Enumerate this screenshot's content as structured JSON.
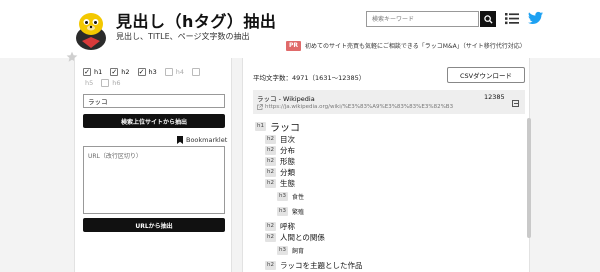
{
  "header": {
    "title": "見出し（hタグ）抽出",
    "subtitle": "見出し、TITLE、ページ文字数の抽出",
    "search_placeholder": "検索キーワード",
    "icons": [
      "mascot-logo",
      "search-icon",
      "menu-list-icon",
      "twitter-icon"
    ]
  },
  "pr": {
    "badge": "PR",
    "text": "初めてのサイト売買も気軽にご相談できる「ラッコM&A」（サイト移行代行対応）"
  },
  "form": {
    "checkboxes": [
      {
        "label": "h1",
        "checked": true,
        "enabled": true
      },
      {
        "label": "h2",
        "checked": true,
        "enabled": true
      },
      {
        "label": "h3",
        "checked": true,
        "enabled": true
      },
      {
        "label": "h4",
        "checked": false,
        "enabled": false
      },
      {
        "label": "h5",
        "checked": false,
        "enabled": false
      },
      {
        "label": "h6",
        "checked": false,
        "enabled": false
      }
    ],
    "keyword_value": "ラッコ",
    "search_button": "検索上位サイトから抽出",
    "bookmarklet_label": "Bookmarklet",
    "url_placeholder": "URL（改行区切り）",
    "url_button": "URLから抽出"
  },
  "results": {
    "avg_text": "平均文字数：4971（1631～12385）",
    "csv_button": "CSVダウンロード",
    "item": {
      "title": "ラッコ - Wikipedia",
      "count": "12385",
      "url": "https://ja.wikipedia.org/wiki/%E3%83%A9%E3%83%83%E3%82%B3"
    },
    "headings": [
      {
        "tag": "h1",
        "text": "ラッコ"
      },
      {
        "tag": "h2",
        "text": "目次"
      },
      {
        "tag": "h2",
        "text": "分布"
      },
      {
        "tag": "h2",
        "text": "形態"
      },
      {
        "tag": "h2",
        "text": "分類"
      },
      {
        "tag": "h2",
        "text": "生態"
      },
      {
        "tag": "h3",
        "text": "食性"
      },
      {
        "tag": "h3",
        "text": "繁殖"
      },
      {
        "tag": "h2",
        "text": "呼称"
      },
      {
        "tag": "h2",
        "text": "人間との関係"
      },
      {
        "tag": "h3",
        "text": "飼育"
      },
      {
        "tag": "h2",
        "text": "ラッコを主題とした作品"
      }
    ]
  },
  "colors": {
    "accent": "#111111",
    "pr_badge": "#e06a6a",
    "twitter": "#1da1f2"
  }
}
